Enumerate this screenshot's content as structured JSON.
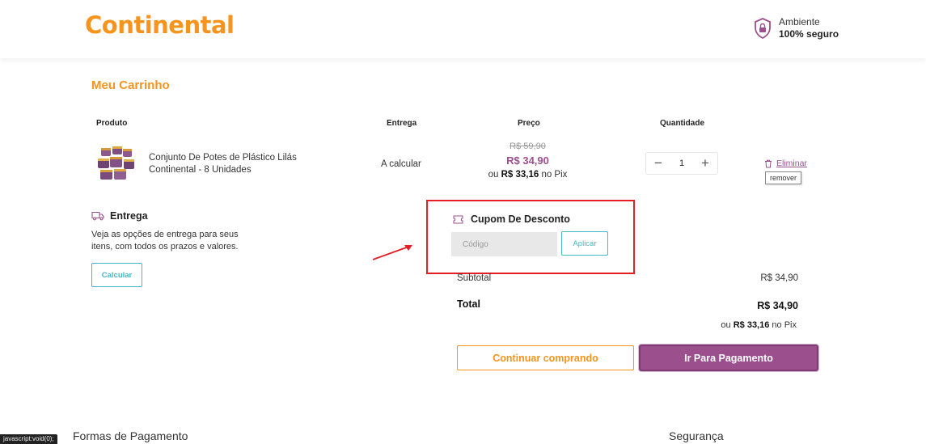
{
  "header": {
    "logo_text": "Continental",
    "secure_line1": "Ambiente",
    "secure_line2": "100% seguro",
    "brand_color": "#f7941d",
    "icon": "shield-lock-icon"
  },
  "cart": {
    "title": "Meu Carrinho",
    "columns": [
      "Produto",
      "Entrega",
      "Preço",
      "Quantidade"
    ],
    "item": {
      "name": "Conjunto De Potes de Plástico Lilás Continental - 8 Unidades",
      "delivery": "A calcular",
      "old_price": "R$ 59,90",
      "price": "R$ 34,90",
      "pix_prefix": "ou ",
      "pix_price": "R$ 33,16",
      "pix_suffix": " no Pix",
      "quantity": "1",
      "remove_label": "Eliminar",
      "remove_tooltip": "remover"
    }
  },
  "shipping": {
    "title": "Entrega",
    "description": "Veja as opções de entrega para seus itens, com todos os prazos e valores.",
    "button_label": "Calcular"
  },
  "coupon": {
    "title": "Cupom De Desconto",
    "placeholder": "Código",
    "apply_label": "Aplicar"
  },
  "summary": {
    "subtotal_label": "Subtotal",
    "subtotal_value": "R$ 34,90",
    "total_label": "Total",
    "total_value": "R$ 34,90",
    "pix_prefix": "ou ",
    "pix_price": "R$ 33,16",
    "pix_suffix": " no Pix",
    "continue_label": "Continuar comprando",
    "pay_label": "Ir Para Pagamento"
  },
  "footer": {
    "payments_title": "Formas de Pagamento",
    "security_title": "Segurança"
  },
  "status_bar": "javascript:void(0);",
  "colors": {
    "accent": "#9b4f8c",
    "teal": "#44b8c4",
    "highlight": "#e31e24"
  }
}
